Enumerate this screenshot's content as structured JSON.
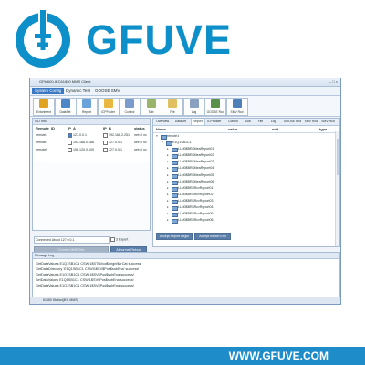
{
  "brand": {
    "name": "GFUVE",
    "url": "WWW.GFUVE.COM",
    "color": "#0d8fc9",
    "footer_color": "#1e8cc8"
  },
  "app": {
    "title": "GFM600-IEC61850 MMS Client",
    "window_controls": "–  □  ×",
    "menu": [
      "System Config",
      "Dynamic Test",
      "GOOSE SMV"
    ],
    "active_menu": "System Config",
    "toolbar": [
      {
        "label": "Extortment",
        "icon": "lightning-icon",
        "color": "#e2a320"
      },
      {
        "label": "DataSet",
        "icon": "dataset-icon",
        "color": "#4d86c7"
      },
      {
        "label": "Report",
        "icon": "report-icon",
        "color": "#6aa3d9"
      },
      {
        "label": "ICPFolder",
        "icon": "folder-icon",
        "color": "#e8b840"
      },
      {
        "label": "Control",
        "icon": "control-icon",
        "color": "#7a9ccc"
      },
      {
        "label": "Sub",
        "icon": "sub-icon",
        "color": "#9ab56a"
      },
      {
        "label": "File",
        "icon": "file-icon",
        "color": "#e0c060"
      },
      {
        "label": "Log",
        "icon": "log-icon",
        "color": "#8aa0c0"
      },
      {
        "label": "GOOSE Rcd",
        "icon": "goose-icon",
        "color": "#5a8f4a"
      },
      {
        "label": "SMV Rcd",
        "icon": "smv-icon",
        "color": "#4f7fb8"
      }
    ],
    "left_panel": {
      "header": "IED Info",
      "columns": [
        "Remote_ID",
        "IP_A",
        "IP_B",
        "status"
      ],
      "rows": [
        {
          "id": "remote1",
          "checked": true,
          "ip_a": "127.0.0.1",
          "ip_b": "192.168.2.251",
          "status": "net<0 nc"
        },
        {
          "id": "remote3",
          "checked": false,
          "ip_a": "192.168.0.188",
          "ip_b": "127.0.0.1",
          "status": "net<0 nc"
        },
        {
          "id": "remote5",
          "checked": false,
          "ip_a": "198.120.0.109",
          "ip_b": "127.0.0.1",
          "status": "net<0 nc"
        }
      ],
      "connect_field": "Connected About 127.0.0.1",
      "expert_label": "3 Expert",
      "connect_button": "Connect MMS Driv",
      "abnormal_button": "Abnormal Reboot",
      "abnormal_abort_button": "Abnormal Abort"
    },
    "right_panel": {
      "tabs": [
        "Overview",
        "DataSet",
        "Report",
        "ICPFolder",
        "Control",
        "Sub",
        "File",
        "Log",
        "GOOSE Rcd",
        "SMV Rcd",
        "SMV Rcd"
      ],
      "active_tab": "Report",
      "columns": [
        "Name",
        "value",
        "edit",
        "type"
      ],
      "tree": [
        {
          "level": 0,
          "label": "remote1"
        },
        {
          "level": 1,
          "label": "E1Q1SB1C1"
        },
        {
          "level": 2,
          "label": "LLN0$BR$MeaReport01"
        },
        {
          "level": 2,
          "label": "LLN0$BR$MeaReport02"
        },
        {
          "level": 2,
          "label": "LLN0$BR$MeaReport03"
        },
        {
          "level": 2,
          "label": "LLN0$BR$MeaReport04"
        },
        {
          "level": 2,
          "label": "LLN0$BR$MeaReport05"
        },
        {
          "level": 2,
          "label": "LLN0$BR$MeaReport06"
        },
        {
          "level": 2,
          "label": "LLN0$BR$RcvReport01"
        },
        {
          "level": 2,
          "label": "LLN0$BR$RcvReport02"
        },
        {
          "level": 2,
          "label": "LLN0$BR$RcvReport03"
        },
        {
          "level": 2,
          "label": "LLN0$BR$RcvReport04"
        },
        {
          "level": 2,
          "label": "LLN0$BR$RcvReport05"
        },
        {
          "level": 2,
          "label": "LLN0$BR$RcvReport06"
        }
      ],
      "accept_begin": "Accept Report Begin",
      "accept_end": "Accept Report End"
    },
    "log": {
      "header": "Message Log",
      "lines": [
        "GetDataValues E1Q1SB1C1 CSWI1$ST$Mod$origin$orCat success!",
        "GetDataDirectory 'E1Q1SB1C1 CSWI1$SV$Pos$subEna' success!",
        "GetDataValues E1Q1SB1C1 CSWI1$SV$Pos$subEna success!",
        "SetDataValues E1Q1SB1C1 CSWI1$SV$Pos$subEna success!",
        "GetDataValues E1Q1SB1C1 CSWI1$SV$Pos$subEna success!"
      ]
    },
    "status": "61850 Station[IEC MMS]"
  }
}
